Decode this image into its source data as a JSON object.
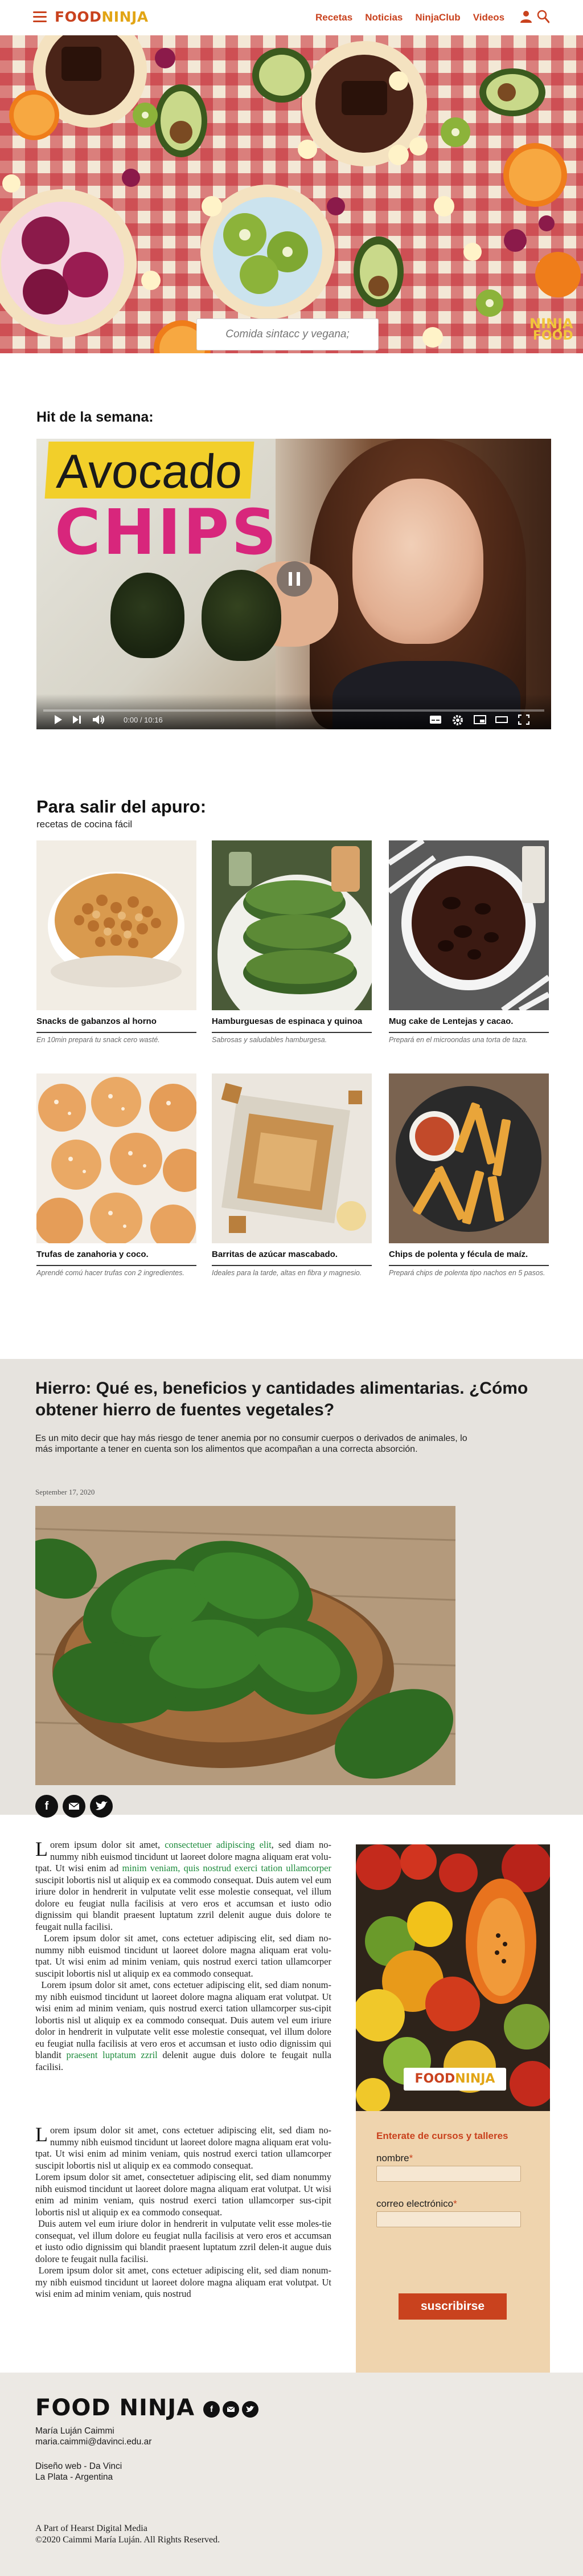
{
  "nav": {
    "logo_food": "FOOD",
    "logo_ninja": "NINJA",
    "links": [
      "Recetas",
      "Noticias",
      "NinjaClub",
      "Videos"
    ],
    "icons": {
      "menu": "hamburger-menu-icon",
      "user": "user-icon",
      "search": "search-icon"
    }
  },
  "hero": {
    "search_placeholder": "Comida sintacc y vegana;",
    "badge_line1": "NINJA",
    "badge_line2": "FOOD"
  },
  "featured": {
    "title": "Hit de la semana:",
    "video": {
      "overlay_line1": "Avocado",
      "overlay_line2": "CHIPS",
      "time_current": "0:00",
      "time_total": "10:16",
      "progress": 0
    }
  },
  "recipes_section": {
    "title": "Para salir del apuro:",
    "subtitle": "recetas de cocina fácil",
    "items": [
      {
        "name": "Snacks de gabanzos al horno",
        "desc": "En 10min prepará tu snack cero wasté."
      },
      {
        "name": "Hamburguesas de espinaca y quinoa",
        "desc": "Sabrosas y saludables hamburgesa."
      },
      {
        "name": "Mug cake de Lentejas y cacao.",
        "desc": "Prepará en el microondas una torta de taza."
      },
      {
        "name": "Trufas de zanahoria y coco.",
        "desc": "Aprendé comú hacer trufas con 2 ingredientes."
      },
      {
        "name": "Barritas de azúcar mascabado.",
        "desc": "Ideales para la tarde, altas en fibra y magnesio."
      },
      {
        "name": "Chips de polenta y fécula de maíz.",
        "desc": "Prepará chips de polenta tipo nachos en 5 pasos."
      }
    ]
  },
  "article": {
    "title": "Hierro: Qué es, beneficios y cantidades alimentarias. ¿Cómo obtener hierro de fuentes vegetales?",
    "lead": "Es un mito decir que hay más riesgo de tener anemia por no consumir cuerpos o derivados de animales, lo más importante a tener en cuenta son los alimentos que acompañan a una correcta absorción.",
    "date": "September 17, 2020",
    "share_icons": [
      "facebook-icon",
      "email-icon",
      "twitter-icon"
    ],
    "para1_dropcap": "L",
    "para1_a": "orem ipsum dolor sit amet, ",
    "para1_link1": "consectetuer adipiscing elit",
    "para1_b": ", sed diam no-nummy nibh euismod tincidunt ut laoreet dolore magna aliquam erat volu-tpat. Ut wisi enim ad ",
    "para1_link2": "minim veniam, quis nostrud exerci tation ullamcorper",
    "para1_c": " suscipit lobortis nisl ut aliquip ex ea commodo consequat. Duis autem vel eum iriure dolor in hendrerit in vulputate velit esse molestie consequat, vel illum dolore eu feugiat nulla facilisis at vero eros et accumsan et iusto odio dignissim qui blandit praesent luptatum zzril delenit augue duis dolore te feugait nulla facilisi.",
    "para2_a": "Lorem ipsum dolor sit amet, cons ectetuer adipiscing elit, sed diam no-nummy nibh euismod tincidunt ut laoreet dolore magna aliquam erat volu-tpat. Ut wisi enim ad minim veniam, quis nostrud exerci tation ullamcorper suscipit lobortis nisl ut aliquip ex ea commodo consequat.",
    "para2_b": "Lorem ipsum dolor sit amet, cons ectetuer adipiscing elit, sed diam nonum-my nibh euismod tincidunt ut laoreet dolore magna aliquam erat volutpat. Ut wisi enim ad minim veniam, quis nostrud exerci tation ullamcorper sus-cipit lobortis nisl ut aliquip ex ea commodo consequat. Duis autem vel eum iriure dolor in hendrerit in vulputate velit esse molestie consequat, vel illum dolore eu feugiat nulla facilisis at vero eros et accumsan et iusto odio dignissim qui blandit ",
    "para2_link": "praesent luptatum zzril",
    "para2_c": " delenit augue duis dolore te feugait nulla facilisi.",
    "para3_dropcap": "L",
    "para3_a": "orem ipsum dolor sit amet, cons ectetuer adipiscing elit, sed diam no-nummy nibh euismod tincidunt ut laoreet dolore magna aliquam erat volu-tpat. Ut wisi enim ad minim veniam, quis nostrud exerci tation ullamcorper suscipit lobortis nisl ut aliquip ex ea commodo consequat.",
    "para3_b": "Lorem ipsum dolor sit amet, consectetuer adipiscing elit, sed diam nonummy nibh euismod tincidunt ut laoreet dolore magna aliquam erat volutpat. Ut wisi enim ad minim veniam, quis nostrud exerci tation ullamcorper sus-cipit lobortis nisl ut aliquip ex ea commodo consequat.",
    "para3_c": "Duis autem vel eum iriure dolor in hendrerit in vulputate velit esse moles-tie consequat, vel illum dolore eu feugiat nulla facilisis at vero eros et accumsan et iusto odio dignissim qui blandit praesent luptatum zzril delen-it augue duis dolore te feugait nulla facilisi.",
    "para3_d": "Lorem ipsum dolor sit amet, cons ectetuer adipiscing elit, sed diam nonum-my nibh euismod tincidunt ut laoreet dolore magna aliquam erat volutpat. Ut wisi enim ad minim veniam, quis nostrud"
  },
  "sidebar": {
    "photo_logo_food": "FOOD",
    "photo_logo_ninja": "NINJA",
    "heading": "Enterate de cursos y talleres",
    "name_label": "nombre",
    "email_label": "correo electrónico",
    "required_mark": "*",
    "submit_label": "suscribirse"
  },
  "footer": {
    "logo": "FOOD NINJA",
    "social_icons": [
      "facebook-icon",
      "email-icon",
      "twitter-icon"
    ],
    "author": "María Luján Caimmi",
    "email": "maria.caimmi@davinci.edu.ar",
    "design_label": "Diseño web",
    "design_value": " - Da Vinci",
    "location": "La Plata - Argentina",
    "media_line1": "A Part of Hearst Digital Media",
    "media_line2": "©2020 Caimmi María Luján. All Rights Reserved."
  },
  "colors": {
    "brand_red": "#c9421e",
    "brand_yellow": "#e2a515",
    "link_green": "#1b8a3a",
    "sidebar_bg": "#efd4ae",
    "article_bg": "#e6e3de",
    "footer_bg": "#ece9e4"
  }
}
